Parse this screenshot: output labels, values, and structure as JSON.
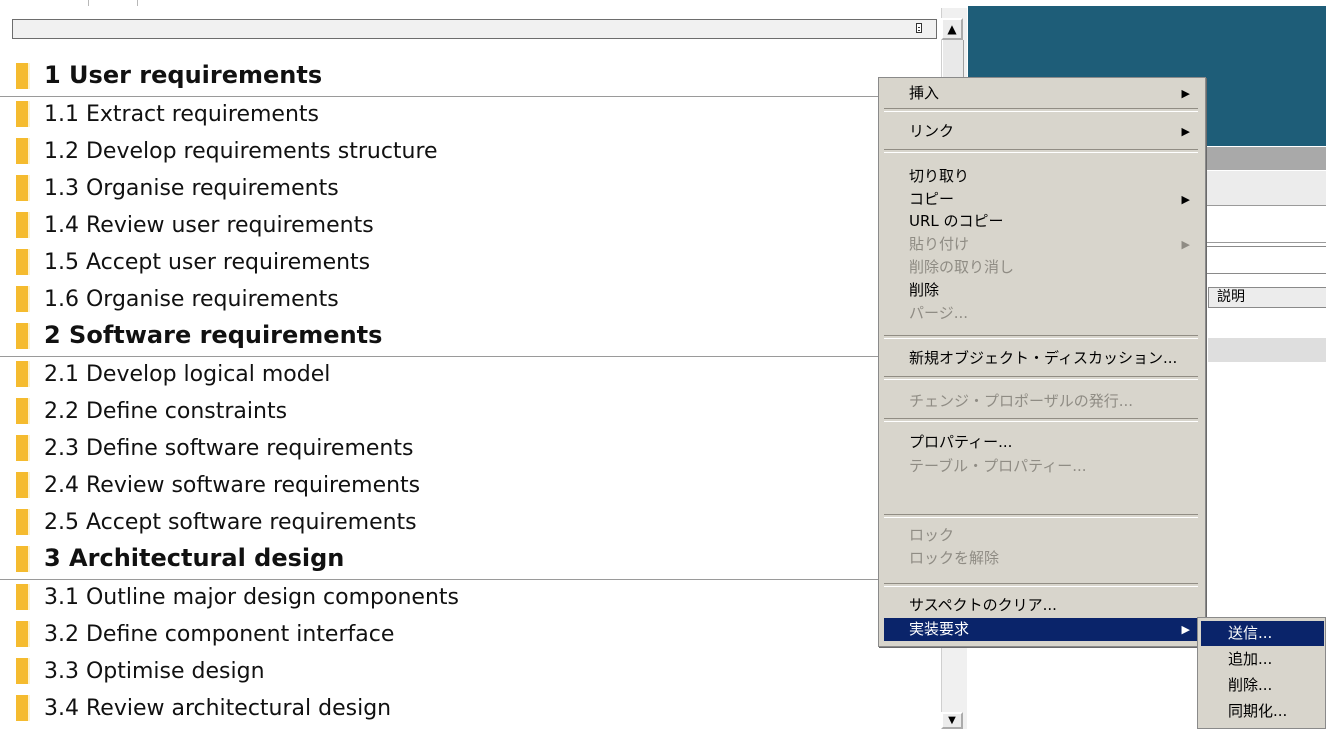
{
  "document": {
    "rows": [
      {
        "text": "1 User requirements",
        "heading": true
      },
      {
        "text": "1.1 Extract requirements",
        "heading": false
      },
      {
        "text": "1.2 Develop requirements structure",
        "heading": false
      },
      {
        "text": "1.3 Organise requirements",
        "heading": false
      },
      {
        "text": "1.4 Review user requirements",
        "heading": false
      },
      {
        "text": "1.5 Accept user requirements",
        "heading": false
      },
      {
        "text": "1.6 Organise requirements",
        "heading": false
      },
      {
        "text": "2 Software requirements",
        "heading": true
      },
      {
        "text": "2.1 Develop logical model",
        "heading": false
      },
      {
        "text": "2.2 Define constraints",
        "heading": false
      },
      {
        "text": "2.3 Define software requirements",
        "heading": false
      },
      {
        "text": "2.4 Review software requirements",
        "heading": false
      },
      {
        "text": "2.5 Accept software requirements",
        "heading": false
      },
      {
        "text": "3 Architectural design",
        "heading": true
      },
      {
        "text": "3.1 Outline major design components",
        "heading": false
      },
      {
        "text": "3.2 Define component interface",
        "heading": false
      },
      {
        "text": "3.3 Optimise design",
        "heading": false
      },
      {
        "text": "3.4 Review architectural design",
        "heading": false
      }
    ]
  },
  "right_panel": {
    "column_header": "説明"
  },
  "context_menu": {
    "insert": "挿入",
    "link": "リンク",
    "cut": "切り取り",
    "copy": "コピー",
    "copy_url": "URL のコピー",
    "paste": "貼り付け",
    "undo_delete": "削除の取り消し",
    "delete": "削除",
    "purge": "パージ...",
    "new_object_discussion": "新規オブジェクト・ディスカッション...",
    "issue_change_proposal": "チェンジ・プロポーザルの発行...",
    "properties": "プロパティー...",
    "table_properties": "テーブル・プロパティー...",
    "lock": "ロック",
    "unlock": "ロックを解除",
    "clear_suspect": "サスペクトのクリア...",
    "implementation_request": "実装要求"
  },
  "submenu": {
    "send": "送信...",
    "add": "追加...",
    "delete": "削除...",
    "sync": "同期化..."
  },
  "colors": {
    "accent_bar": "#f5bb2f",
    "banner": "#1e5d78",
    "menu_highlight": "#0a246a"
  }
}
